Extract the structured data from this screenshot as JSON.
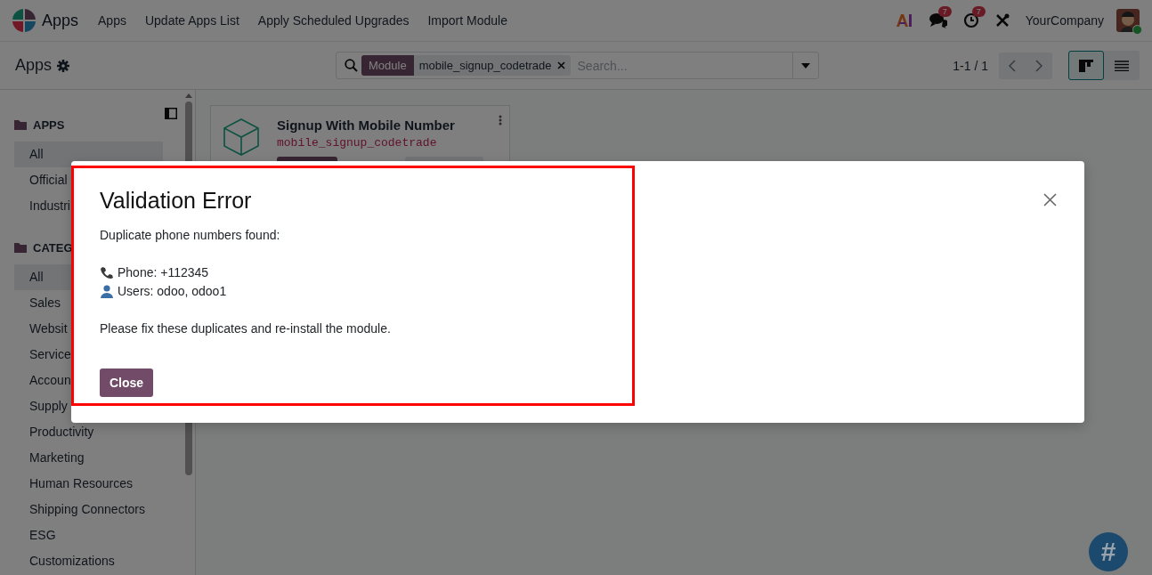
{
  "navbar": {
    "app_name": "Apps",
    "menu": [
      "Apps",
      "Update Apps List",
      "Apply Scheduled Upgrades",
      "Import Module"
    ],
    "systray": {
      "messages_badge": "7",
      "activities_badge": "7",
      "company": "YourCompany"
    }
  },
  "control_panel": {
    "title": "Apps",
    "search": {
      "facets": [
        {
          "label": "Module",
          "value": "mobile_signup_codetrade"
        }
      ],
      "placeholder": "Search..."
    },
    "pager": "1-1 / 1",
    "views": [
      {
        "kind": "kanban",
        "selected": true
      },
      {
        "kind": "list",
        "selected": false
      }
    ]
  },
  "sidebar": {
    "sections": [
      {
        "title": "APPS",
        "items": [
          {
            "label": "All",
            "selected": true
          },
          {
            "label": "Official",
            "selected": false
          },
          {
            "label": "Industri",
            "selected": false
          }
        ]
      },
      {
        "title": "CATEG",
        "items": [
          {
            "label": "All",
            "selected": true
          },
          {
            "label": "Sales",
            "selected": false
          },
          {
            "label": "Websit",
            "selected": false
          },
          {
            "label": "Service",
            "selected": false
          },
          {
            "label": "Accoun",
            "selected": false
          },
          {
            "label": "Supply",
            "selected": false
          },
          {
            "label": "Productivity",
            "selected": false
          },
          {
            "label": "Marketing",
            "selected": false
          },
          {
            "label": "Human Resources",
            "selected": false
          },
          {
            "label": "Shipping Connectors",
            "selected": false
          },
          {
            "label": "ESG",
            "selected": false
          },
          {
            "label": "Customizations",
            "selected": false
          }
        ]
      }
    ]
  },
  "cards": [
    {
      "name": "Signup With Mobile Number",
      "technical_name": "mobile_signup_codetrade"
    }
  ],
  "dialog": {
    "title": "Validation Error",
    "paragraphs": [
      {
        "lines": [
          {
            "kind": "text",
            "text": "Duplicate phone numbers found:"
          }
        ]
      },
      {
        "lines": [
          {
            "kind": "phone",
            "text": "Phone: +112345"
          },
          {
            "kind": "user",
            "text": "Users: odoo, odoo1"
          }
        ]
      },
      {
        "lines": [
          {
            "kind": "text",
            "text": "Please fix these duplicates and re-install the module."
          }
        ]
      }
    ],
    "close_button": "Close"
  },
  "help_button": "#"
}
